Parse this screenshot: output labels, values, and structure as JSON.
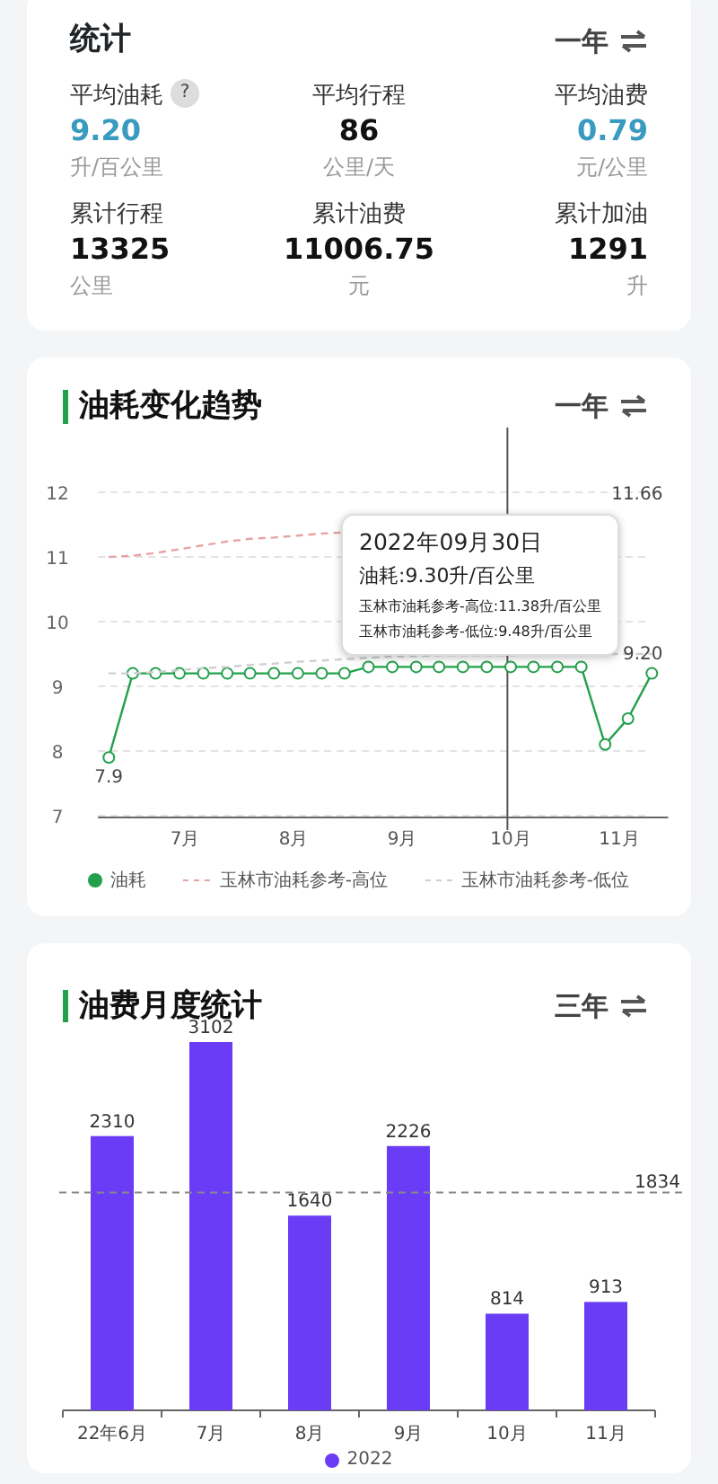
{
  "summary": {
    "title": "统计",
    "period": "一年",
    "help": "?",
    "stats": [
      {
        "label": "平均油耗",
        "value": "9.20",
        "unit": "升/百公里",
        "highlight": true,
        "help": true
      },
      {
        "label": "平均行程",
        "value": "86",
        "unit": "公里/天",
        "highlight": false,
        "help": false
      },
      {
        "label": "平均油费",
        "value": "0.79",
        "unit": "元/公里",
        "highlight": true,
        "help": false
      },
      {
        "label": "累计行程",
        "value": "13325",
        "unit": "公里",
        "highlight": false,
        "help": false
      },
      {
        "label": "累计油费",
        "value": "11006.75",
        "unit": "元",
        "highlight": false,
        "help": false
      },
      {
        "label": "累计加油",
        "value": "1291",
        "unit": "升",
        "highlight": false,
        "help": false
      }
    ]
  },
  "trend": {
    "title": "油耗变化趋势",
    "period": "一年",
    "chart_data": {
      "type": "line",
      "x": [
        6.3,
        6.52,
        6.73,
        6.95,
        7.17,
        7.39,
        7.6,
        7.82,
        8.04,
        8.26,
        8.47,
        8.69,
        8.91,
        9.13,
        9.34,
        9.56,
        9.78,
        10.0,
        10.21,
        10.43,
        10.65,
        10.87,
        11.08,
        11.3
      ],
      "xlim": [
        6.2,
        11.45
      ],
      "grid": true,
      "ref_lines": [
        {
          "axis": "x",
          "value": 9.97
        }
      ],
      "xticks": [
        {
          "value": 7,
          "label": "7月"
        },
        {
          "value": 8,
          "label": "8月"
        },
        {
          "value": 9,
          "label": "9月"
        },
        {
          "value": 10,
          "label": "10月"
        },
        {
          "value": 11,
          "label": "11月"
        }
      ],
      "yticks": [
        7,
        8,
        9,
        10,
        11,
        12
      ],
      "ylim": [
        7,
        12
      ],
      "series": [
        {
          "name": "油耗",
          "color": "#22a04b",
          "marker": "circle",
          "values": [
            7.9,
            9.2,
            9.2,
            9.2,
            9.2,
            9.2,
            9.2,
            9.2,
            9.2,
            9.2,
            9.2,
            9.3,
            9.3,
            9.3,
            9.3,
            9.3,
            9.3,
            9.3,
            9.3,
            9.3,
            9.3,
            8.1,
            8.5,
            9.2
          ]
        },
        {
          "name": "玉林市油耗参考-高位",
          "color": "#e7a3a3",
          "line_style": "dashed",
          "values": [
            11.0,
            11.02,
            11.06,
            11.12,
            11.18,
            11.24,
            11.28,
            11.3,
            11.33,
            11.36,
            11.38,
            null,
            null,
            null,
            null,
            null,
            null,
            null,
            null,
            null,
            null,
            null,
            null,
            null
          ]
        },
        {
          "name": "玉林市油耗参考-低位",
          "color": "#cfcfcf",
          "line_style": "dashed",
          "values": [
            9.2,
            9.2,
            9.22,
            9.25,
            9.28,
            9.3,
            9.33,
            9.35,
            9.38,
            9.4,
            9.42,
            9.44,
            9.46,
            9.47,
            9.48,
            9.48,
            9.48,
            9.48,
            9.5,
            9.5,
            9.5,
            9.5,
            9.5,
            9.5
          ]
        }
      ],
      "annotations": [
        "11.66",
        "9.20",
        "7.9"
      ]
    },
    "tooltip": {
      "date": "2022年09月30日",
      "lines": [
        {
          "text": "油耗:9.30升/百公里",
          "kind": "main"
        },
        {
          "text": "玉林市油耗参考-高位:11.38升/百公里",
          "kind": "ref"
        },
        {
          "text": "玉林市油耗参考-低位:9.48升/百公里",
          "kind": "ref"
        }
      ]
    }
  },
  "monthly": {
    "title": "油费月度统计",
    "period": "三年",
    "chart_data": {
      "type": "bar",
      "categories": [
        "22年6月",
        "7月",
        "8月",
        "9月",
        "10月",
        "11月"
      ],
      "data_labels": true,
      "series": [
        {
          "name": "2022",
          "color": "#6a3cf5",
          "values": [
            2310,
            3102,
            1640,
            2226,
            814,
            913
          ]
        }
      ],
      "ref_lines": [
        {
          "axis": "y",
          "value": 1834,
          "label": "1834"
        }
      ]
    }
  }
}
